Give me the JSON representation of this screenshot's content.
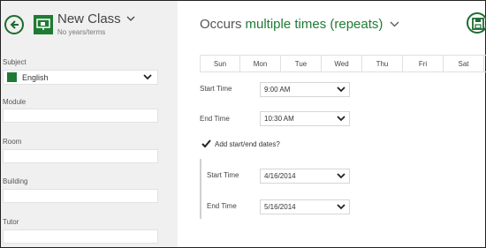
{
  "header": {
    "title": "New Class",
    "subtitle": "No years/terms"
  },
  "left_panel": {
    "subject": {
      "label": "Subject",
      "value": "English",
      "color": "#1e7b34"
    },
    "module": {
      "label": "Module",
      "value": ""
    },
    "room": {
      "label": "Room",
      "value": ""
    },
    "building": {
      "label": "Building",
      "value": ""
    },
    "tutor": {
      "label": "Tutor",
      "value": ""
    }
  },
  "schedule": {
    "occurs_prefix": "Occurs",
    "occurs_value": "multiple times (repeats)",
    "days": [
      "Sun",
      "Mon",
      "Tue",
      "Wed",
      "Thu",
      "Fri",
      "Sat"
    ],
    "start_time": {
      "label": "Start Time",
      "value": "9:00 AM"
    },
    "end_time": {
      "label": "End Time",
      "value": "10:30 AM"
    },
    "add_dates": {
      "label": "Add start/end dates?",
      "checked": true
    },
    "start_date": {
      "label": "Start Time",
      "value": "4/16/2014"
    },
    "end_date": {
      "label": "End Time",
      "value": "5/16/2014"
    }
  },
  "colors": {
    "accent": "#1e7b34",
    "panel_bg": "#f0f0f0"
  },
  "icons": {
    "back": "back-arrow-icon",
    "class": "presentation-icon",
    "save": "save-icon",
    "dropdown": "chevron-down-icon",
    "check": "checkmark-icon"
  }
}
